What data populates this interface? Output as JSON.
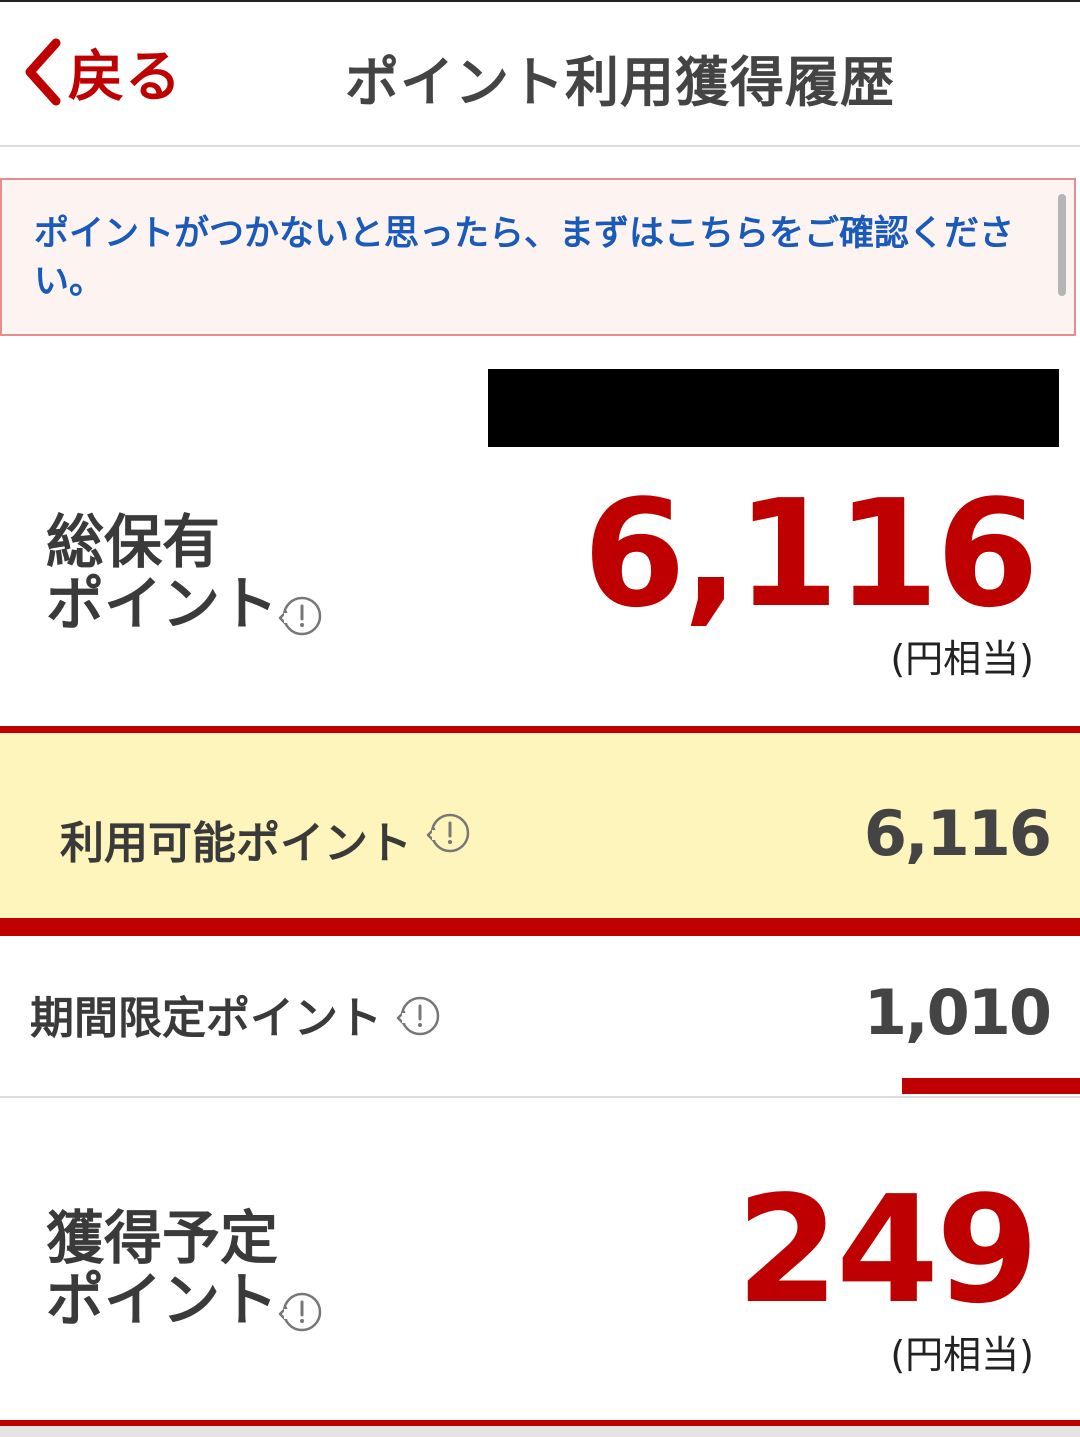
{
  "header": {
    "back_label": "戻る",
    "title": "ポイント利用獲得履歴"
  },
  "notice": {
    "text": "ポイントがつかないと思ったら、まずはこちらをご確認ください。"
  },
  "total": {
    "label_line1": "総保有",
    "label_line2": "ポイント",
    "value": "6,116",
    "unit": "(円相当)"
  },
  "available": {
    "label": "利用可能ポイント",
    "value": "6,116"
  },
  "limited": {
    "label": "期間限定ポイント",
    "value": "1,010"
  },
  "pending": {
    "label_line1": "獲得予定",
    "label_line2": "ポイント",
    "value": "249",
    "unit": "(円相当)"
  },
  "colors": {
    "accent": "#bf0000",
    "link": "#1a5ab8",
    "highlight_bg": "#fdf5bc",
    "notice_bg": "#fdf4f2"
  }
}
